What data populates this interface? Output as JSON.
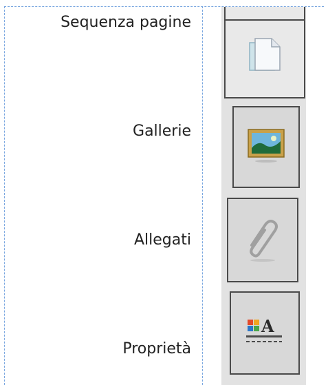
{
  "panel": {
    "items": [
      {
        "label": "Sequenza pagine",
        "icon": "pages-icon"
      },
      {
        "label": "Gallerie",
        "icon": "gallery-icon"
      },
      {
        "label": "Allegati",
        "icon": "paperclip-icon"
      },
      {
        "label": "Proprietà",
        "icon": "properties-icon"
      }
    ],
    "selected_index": 0
  },
  "colors": {
    "guide": "#7aa7e0",
    "tab_border": "#4a4a4a",
    "strip_bg": "#e2e2e2"
  }
}
